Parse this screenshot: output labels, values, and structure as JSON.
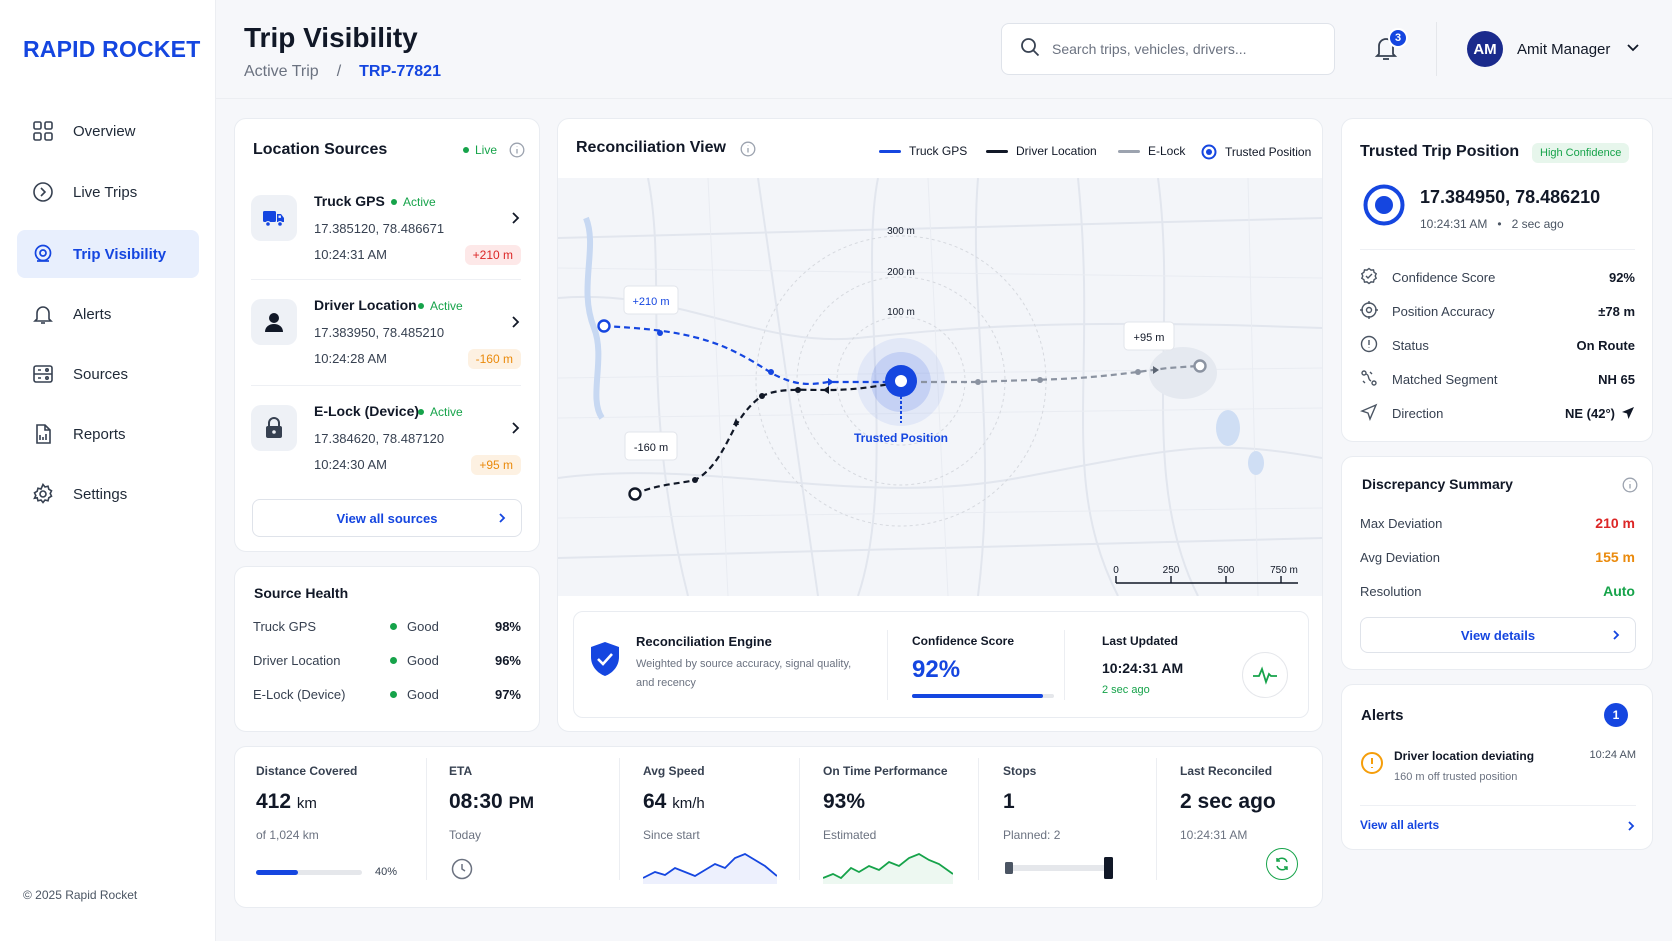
{
  "app": {
    "brand": "RAPID ROCKET",
    "copyright": "© 2025  Rapid Rocket"
  },
  "sidebar": {
    "items": [
      {
        "label": "Overview",
        "icon": "grid-icon"
      },
      {
        "label": "Live Trips",
        "icon": "clock-icon"
      },
      {
        "label": "Trip Visibility",
        "icon": "location-pin-icon",
        "active": true
      },
      {
        "label": "Alerts",
        "icon": "bell-icon"
      },
      {
        "label": "Sources",
        "icon": "sources-icon"
      },
      {
        "label": "Reports",
        "icon": "document-icon"
      },
      {
        "label": "Settings",
        "icon": "gear-icon"
      }
    ]
  },
  "header": {
    "title": "Trip Visibility",
    "breadcrumb": [
      "Active Trip",
      "/",
      "TRP-77821"
    ],
    "search_placeholder": "Search trips, vehicles, drivers...",
    "notification_count": "3",
    "user": {
      "initials": "AM",
      "name": "Amit Manager"
    }
  },
  "location_sources": {
    "title": "Location Sources",
    "live": "Live",
    "sources": [
      {
        "name": "Truck GPS",
        "status": "Active",
        "coords": "17.385120, 78.486671",
        "time": "10:24:31 AM",
        "offset": "+210 m",
        "icon": "truck-icon"
      },
      {
        "name": "Driver Location",
        "status": "Active",
        "coords": "17.383950, 78.485210",
        "time": "10:24:28 AM",
        "offset": "-160 m",
        "icon": "user-icon"
      },
      {
        "name": "E-Lock (Device)",
        "status": "Active",
        "coords": "17.384620, 78.487120",
        "time": "10:24:30 AM",
        "offset": "+95 m",
        "icon": "lock-icon"
      }
    ],
    "view_all": "View all sources"
  },
  "source_health": {
    "title": "Source Health",
    "rows": [
      {
        "name": "Truck GPS",
        "status": "Good",
        "pct": "98%"
      },
      {
        "name": "Driver Location",
        "status": "Good",
        "pct": "96%"
      },
      {
        "name": "E-Lock (Device)",
        "status": "Good",
        "pct": "97%"
      }
    ]
  },
  "reconciliation": {
    "title": "Reconciliation View",
    "legend": [
      "Truck GPS",
      "Driver Location",
      "E-Lock",
      "Trusted Position"
    ],
    "rings": [
      "300 m",
      "200 m",
      "100 m"
    ],
    "trusted_label": "Trusted Position",
    "callouts": [
      "+210 m",
      "-160 m",
      "+95 m"
    ],
    "scale": [
      "0",
      "250",
      "500",
      "750 m"
    ],
    "engine": {
      "title": "Reconciliation Engine",
      "desc_line1": "Weighted by source accuracy, signal quality,",
      "desc_line2": "and recency",
      "score_label": "Confidence Score",
      "score": "92%",
      "score_fraction": 0.92,
      "updated_label": "Last Updated",
      "updated_time": "10:24:31 AM",
      "updated_ago": "2 sec ago"
    },
    "colors": {
      "truck": "#1546e0",
      "driver": "#111827",
      "elock": "#9ca3af"
    }
  },
  "trusted_position": {
    "title": "Trusted Trip Position",
    "badge": "High Confidence",
    "coords": "17.384950, 78.486210",
    "time": "10:24:31 AM",
    "ago": "2 sec ago",
    "rows": [
      {
        "label": "Confidence Score",
        "value": "92%",
        "icon": "shield-check-icon"
      },
      {
        "label": "Position Accuracy",
        "value": "±78 m",
        "icon": "target-icon"
      },
      {
        "label": "Status",
        "value": "On Route",
        "icon": "info-icon"
      },
      {
        "label": "Matched Segment",
        "value": "NH 65",
        "icon": "route-icon"
      },
      {
        "label": "Direction",
        "value": "NE (42°)",
        "icon": "navigation-icon"
      }
    ]
  },
  "discrepancy": {
    "title": "Discrepancy Summary",
    "rows": [
      {
        "label": "Max Deviation",
        "value": "210 m"
      },
      {
        "label": "Avg Deviation",
        "value": "155 m"
      },
      {
        "label": "Resolution",
        "value": "Auto"
      }
    ],
    "view_details": "View details"
  },
  "alerts": {
    "title": "Alerts",
    "count": "1",
    "item": {
      "title": "Driver location deviating",
      "sub": "160 m off trusted position",
      "time": "10:24 AM"
    },
    "view_all": "View all alerts"
  },
  "stats": [
    {
      "label": "Distance Covered",
      "value": "412",
      "unit": "km",
      "sub": "of 1,024 km",
      "progress_label": "40%",
      "progress": 0.4
    },
    {
      "label": "ETA",
      "value": "08:30",
      "unit": "PM",
      "sub": "Today"
    },
    {
      "label": "Avg Speed",
      "value": "64",
      "unit": "km/h",
      "sub": "Since start"
    },
    {
      "label": "On Time Performance",
      "value": "93%",
      "unit": "",
      "sub": "Estimated"
    },
    {
      "label": "Stops",
      "value": "1",
      "unit": "",
      "sub": "Planned: 2"
    },
    {
      "label": "Last Reconciled",
      "value": "2 sec ago",
      "unit": "",
      "sub": "10:24:31 AM"
    }
  ]
}
